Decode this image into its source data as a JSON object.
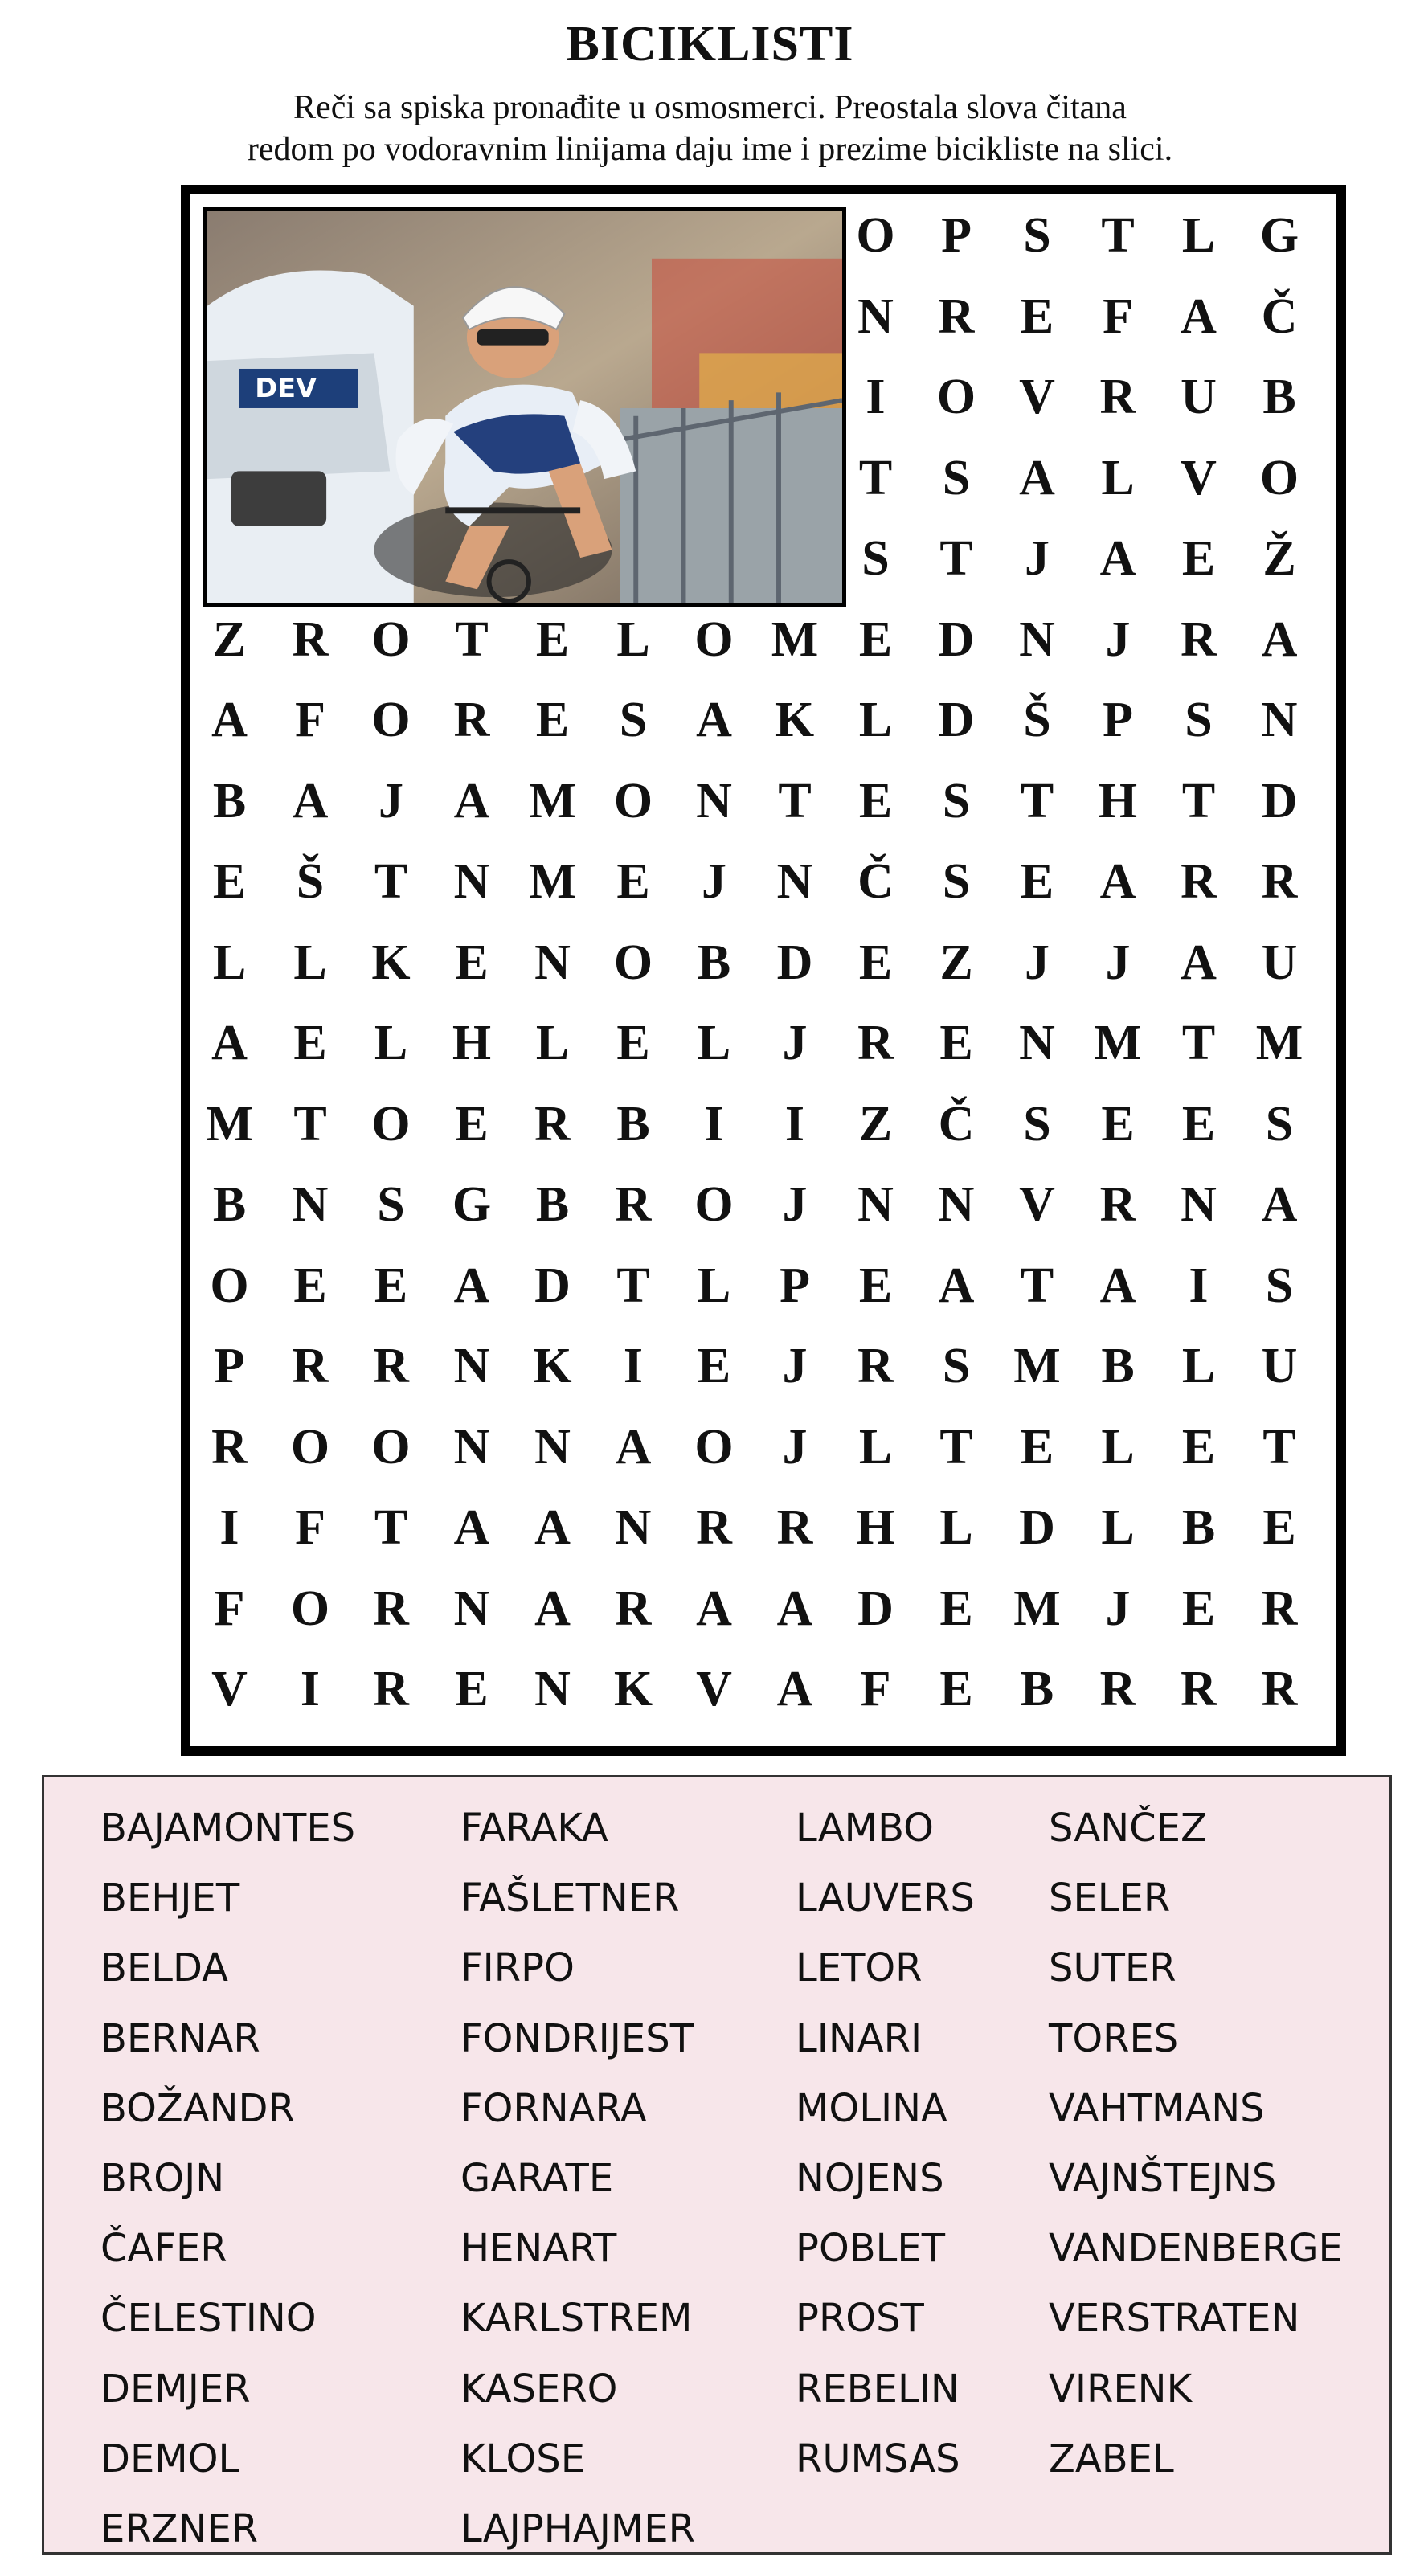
{
  "title": "BICIKLISTI",
  "instructions": [
    "Reči sa spiska pronađite u osmosmerci. Preostala slova čitana",
    "redom po vodoravnim linijama daju ime i prezime bicikliste na slici."
  ],
  "photo": {
    "alt_icon": "cyclist-photo",
    "car_plate_text": "DEV"
  },
  "grid_top_rows": [
    "OPSTLG",
    "NREFAČ",
    "IOVRUB",
    "TSALVO",
    "STJAEŽ"
  ],
  "grid_full_rows": [
    "ZROTELOMEDNJRA",
    "AFORESAKLDŠPSN",
    "BAJAMONTESTHTD",
    "EŠTNMEJNČSEARR",
    "LLKENOBDEZJJAU",
    "AELHLELJRENMTM",
    "MTOERBIIZČSEES",
    "BNSGBROJNNVRNA",
    "OEEADTLPEATAIS",
    "PRRNKIEJRSMBLU",
    "ROONNAOJLTELET",
    "IFTAANRRHLDLBE",
    "FORNARAADEMJER",
    "VIRENKVAFEBRRR"
  ],
  "word_columns": [
    [
      "BAJAMONTES",
      "BEHJET",
      "BELDA",
      "BERNAR",
      "BOŽANDR",
      "BROJN",
      "ČAFER",
      "ČELESTINO",
      "DEMJER",
      "DEMOL",
      "ERZNER"
    ],
    [
      "FARAKA",
      "FAŠLETNER",
      "FIRPO",
      "FONDRIJEST",
      "FORNARA",
      "GARATE",
      "HENART",
      "KARLSTREM",
      "KASERO",
      "KLOSE",
      "LAJPHAJMER"
    ],
    [
      "LAMBO",
      "LAUVERS",
      "LETOR",
      "LINARI",
      "MOLINA",
      "NOJENS",
      "POBLET",
      "PROST",
      "REBELIN",
      "RUMSAS"
    ],
    [
      "SANČEZ",
      "SELER",
      "SUTER",
      "TORES",
      "VAHTMANS",
      "VAJNŠTEJNS",
      "VANDENBERGE",
      "VERSTRATEN",
      "VIRENK",
      "ZABEL"
    ]
  ],
  "colors": {
    "wordlist_bg": "#f7e6ea",
    "border": "#000000"
  }
}
